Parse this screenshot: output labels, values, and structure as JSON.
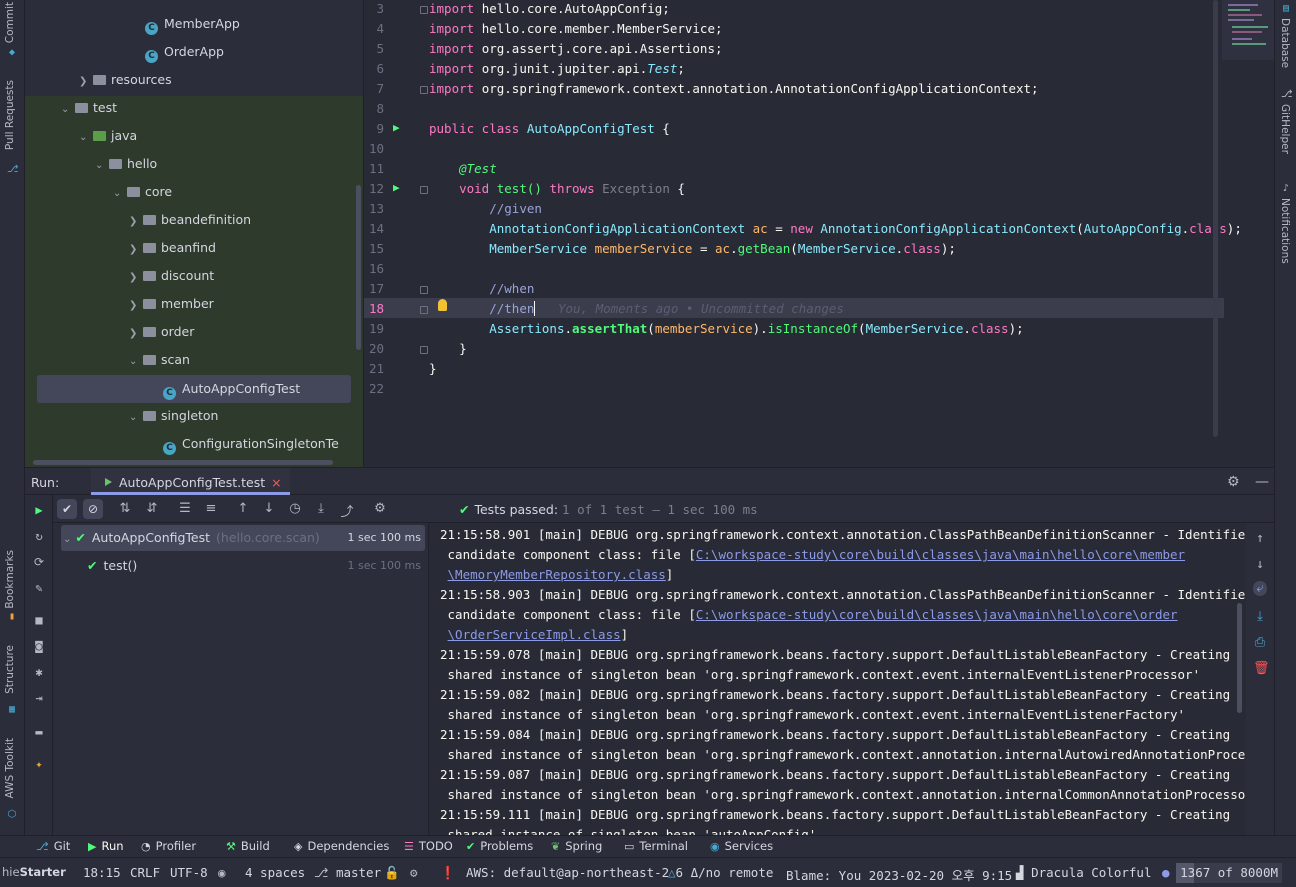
{
  "left_strip": {
    "commit": "Commit",
    "pull_requests": "Pull Requests",
    "bookmarks": "Bookmarks",
    "structure": "Structure",
    "aws_toolkit": "AWS Toolkit"
  },
  "right_strip": {
    "database": "Database",
    "githelper": "GitHelper",
    "notifications": "Notifications"
  },
  "project_tree": {
    "member_app": "MemberApp",
    "order_app": "OrderApp",
    "resources": "resources",
    "test": "test",
    "java": "java",
    "hello": "hello",
    "core": "core",
    "beandefinition": "beandefinition",
    "beanfind": "beanfind",
    "discount": "discount",
    "member": "member",
    "order": "order",
    "scan": "scan",
    "auto_app_config_test": "AutoAppConfigTest",
    "singleton": "singleton",
    "configuration_singleton": "ConfigurationSingletonTe"
  },
  "editor": {
    "line_numbers": [
      "3",
      "4",
      "5",
      "6",
      "7",
      "8",
      "9",
      "10",
      "11",
      "12",
      "13",
      "14",
      "15",
      "16",
      "17",
      "18",
      "19",
      "20",
      "21",
      "22"
    ],
    "imports": {
      "l3": "hello.core.AutoAppConfig;",
      "l4": "hello.core.member.MemberService;",
      "l5": "org.assertj.core.api.Assertions;",
      "l6_pkg": "org.junit.jupiter.api.",
      "l6_cls": "Test",
      "l7": "org.springframework.context.annotation.AnnotationConfigApplicationContext;"
    },
    "keywords": {
      "import": "import",
      "public_class": "public class",
      "void": "void",
      "throws": "throws",
      "new": "new",
      "class": "class"
    },
    "class_name": "AutoAppConfigTest",
    "annotation": "@Test",
    "method": "test()",
    "exception": "Exception",
    "comment_given": "//given",
    "comment_when": "//when",
    "comment_then": "//then",
    "blame": "You, Moments ago • Uncommitted changes",
    "types": {
      "acac": "AnnotationConfigApplicationContext",
      "auto_app_config": "AutoAppConfig",
      "member_service": "MemberService",
      "assertions": "Assertions"
    },
    "vars": {
      "ac": "ac",
      "member_service": "memberService"
    },
    "calls": {
      "get_bean": "getBean",
      "assert_that": "assertThat",
      "is_instance_of": "isInstanceOf"
    }
  },
  "run_panel": {
    "label": "Run:",
    "tab": "AutoAppConfigTest.test",
    "tests_passed": "Tests passed:",
    "tests_summary": "1 of 1 test – 1 sec 100 ms",
    "tree": {
      "suite": "AutoAppConfigTest",
      "suite_pkg": "(hello.core.scan)",
      "suite_time": "1 sec 100 ms",
      "test": "test()",
      "test_time": "1 sec 100 ms"
    },
    "console": {
      "l1": "21:15:58.901 [main] DEBUG org.springframework.context.annotation.ClassPathBeanDefinitionScanner - Identified",
      "l2_pre": " candidate component class: file [",
      "l2_link": "C:\\workspace-study\\core\\build\\classes\\java\\main\\hello\\core\\member",
      "l3_link": "\\MemoryMemberRepository.class",
      "l3_post": "]",
      "l4": "21:15:58.903 [main] DEBUG org.springframework.context.annotation.ClassPathBeanDefinitionScanner - Identified",
      "l5_pre": " candidate component class: file [",
      "l5_link": "C:\\workspace-study\\core\\build\\classes\\java\\main\\hello\\core\\order",
      "l6_link": "\\OrderServiceImpl.class",
      "l6_post": "]",
      "l7": "21:15:59.078 [main] DEBUG org.springframework.beans.factory.support.DefaultListableBeanFactory - Creating",
      "l8": " shared instance of singleton bean 'org.springframework.context.event.internalEventListenerProcessor'",
      "l9": "21:15:59.082 [main] DEBUG org.springframework.beans.factory.support.DefaultListableBeanFactory - Creating",
      "l10": " shared instance of singleton bean 'org.springframework.context.event.internalEventListenerFactory'",
      "l11": "21:15:59.084 [main] DEBUG org.springframework.beans.factory.support.DefaultListableBeanFactory - Creating",
      "l12": " shared instance of singleton bean 'org.springframework.context.annotation.internalAutowiredAnnotationProcessor'",
      "l13": "21:15:59.087 [main] DEBUG org.springframework.beans.factory.support.DefaultListableBeanFactory - Creating",
      "l14": " shared instance of singleton bean 'org.springframework.context.annotation.internalCommonAnnotationProcessor'",
      "l15": "21:15:59.111 [main] DEBUG org.springframework.beans.factory.support.DefaultListableBeanFactory - Creating",
      "l16": " shared instance of singleton bean 'autoAppConfig'"
    }
  },
  "tool_windows": {
    "git": "Git",
    "run": "Run",
    "profiler": "Profiler",
    "build": "Build",
    "dependencies": "Dependencies",
    "todo": "TODO",
    "problems": "Problems",
    "spring": "Spring",
    "terminal": "Terminal",
    "services": "Services"
  },
  "status_bar": {
    "starter": "Starter",
    "starter_prefix": "hie",
    "position": "18:15",
    "line_sep": "CRLF",
    "encoding": "UTF-8",
    "indent": "4 spaces",
    "branch": "master",
    "aws": "AWS: default@ap-northeast-2",
    "git_remote": "6 Δ/no remote",
    "blame": "Blame: You 2023-02-20 오후 9:15",
    "theme": "Dracula Colorful",
    "memory": "1367 of 8000M",
    "memory_used_fraction": 0.17
  },
  "colors": {
    "accent": "#8d9ae5",
    "pass": "#50fa7b",
    "keyword": "#ff79c6"
  }
}
